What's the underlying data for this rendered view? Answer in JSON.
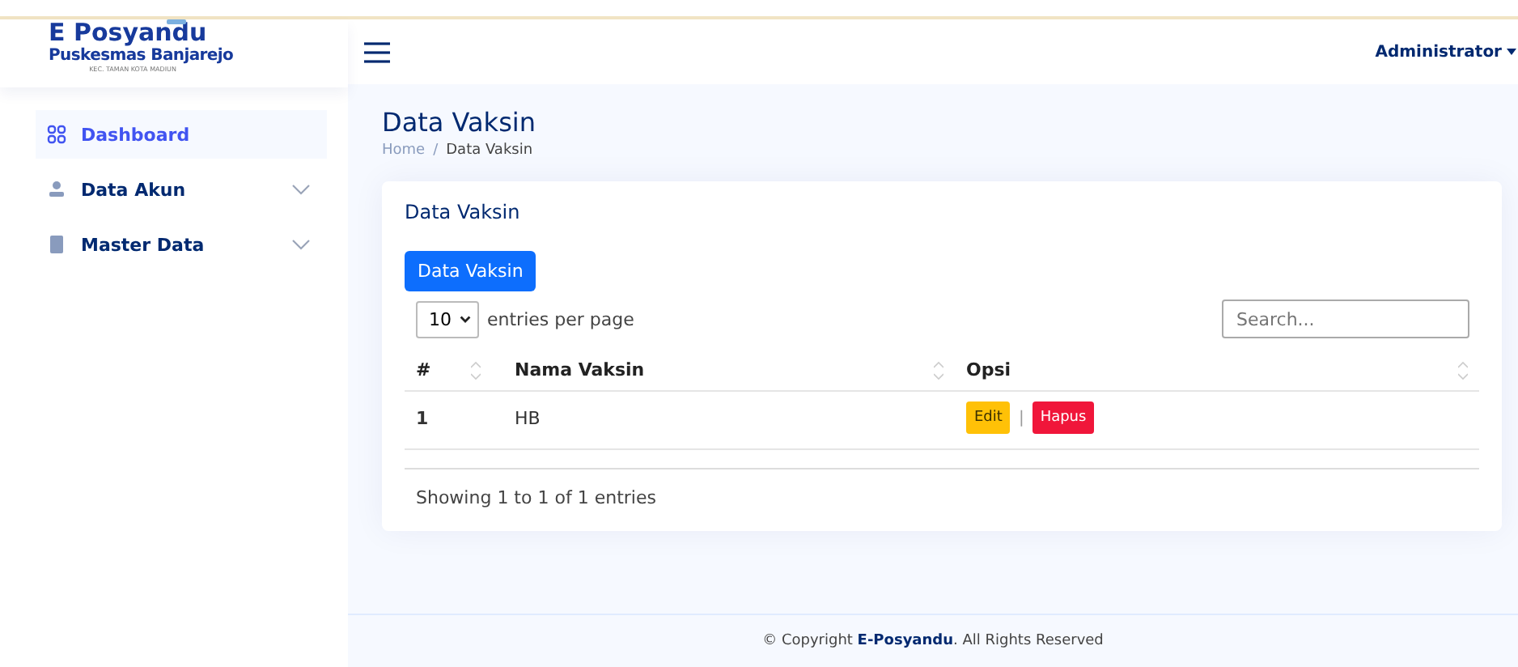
{
  "logo": {
    "title": "E Posyandu",
    "subtitle": "Puskesmas Banjarejo",
    "caption": "KEC. TAMAN KOTA MADIUN"
  },
  "header": {
    "user": "Administrator"
  },
  "sidebar": {
    "items": [
      {
        "label": "Dashboard",
        "kind": "grid",
        "selected": true
      },
      {
        "label": "Data Akun",
        "kind": "person",
        "selected": false,
        "expanded": false
      },
      {
        "label": "Master Data",
        "kind": "document",
        "selected": false,
        "expanded": false
      }
    ]
  },
  "page": {
    "title": "Data Vaksin",
    "breadcrumb": [
      "Home",
      "Data Vaksin"
    ],
    "breadcrumb_separator": "/"
  },
  "card": {
    "title": "Data Vaksin",
    "add_button": "Data Vaksin",
    "per_page": "10",
    "per_page_label": "entries per page",
    "search": {
      "placeholder": "Search..."
    },
    "columns": [
      "#",
      "Nama Vaksin",
      "Opsi"
    ],
    "rows": [
      {
        "no": "1",
        "name": "HB",
        "actions": [
          {
            "label": "Edit",
            "kind": "edit"
          },
          {
            "label": "Hapus",
            "kind": "delete"
          }
        ],
        "separator": "|"
      }
    ],
    "info": [
      "Showing ",
      "1",
      " to ",
      "1",
      " of ",
      "1",
      " entries"
    ]
  },
  "footer": {
    "prefix": "© Copyright ",
    "brand": "E-Posyandu",
    "suffix": ". All Rights Reserved"
  }
}
